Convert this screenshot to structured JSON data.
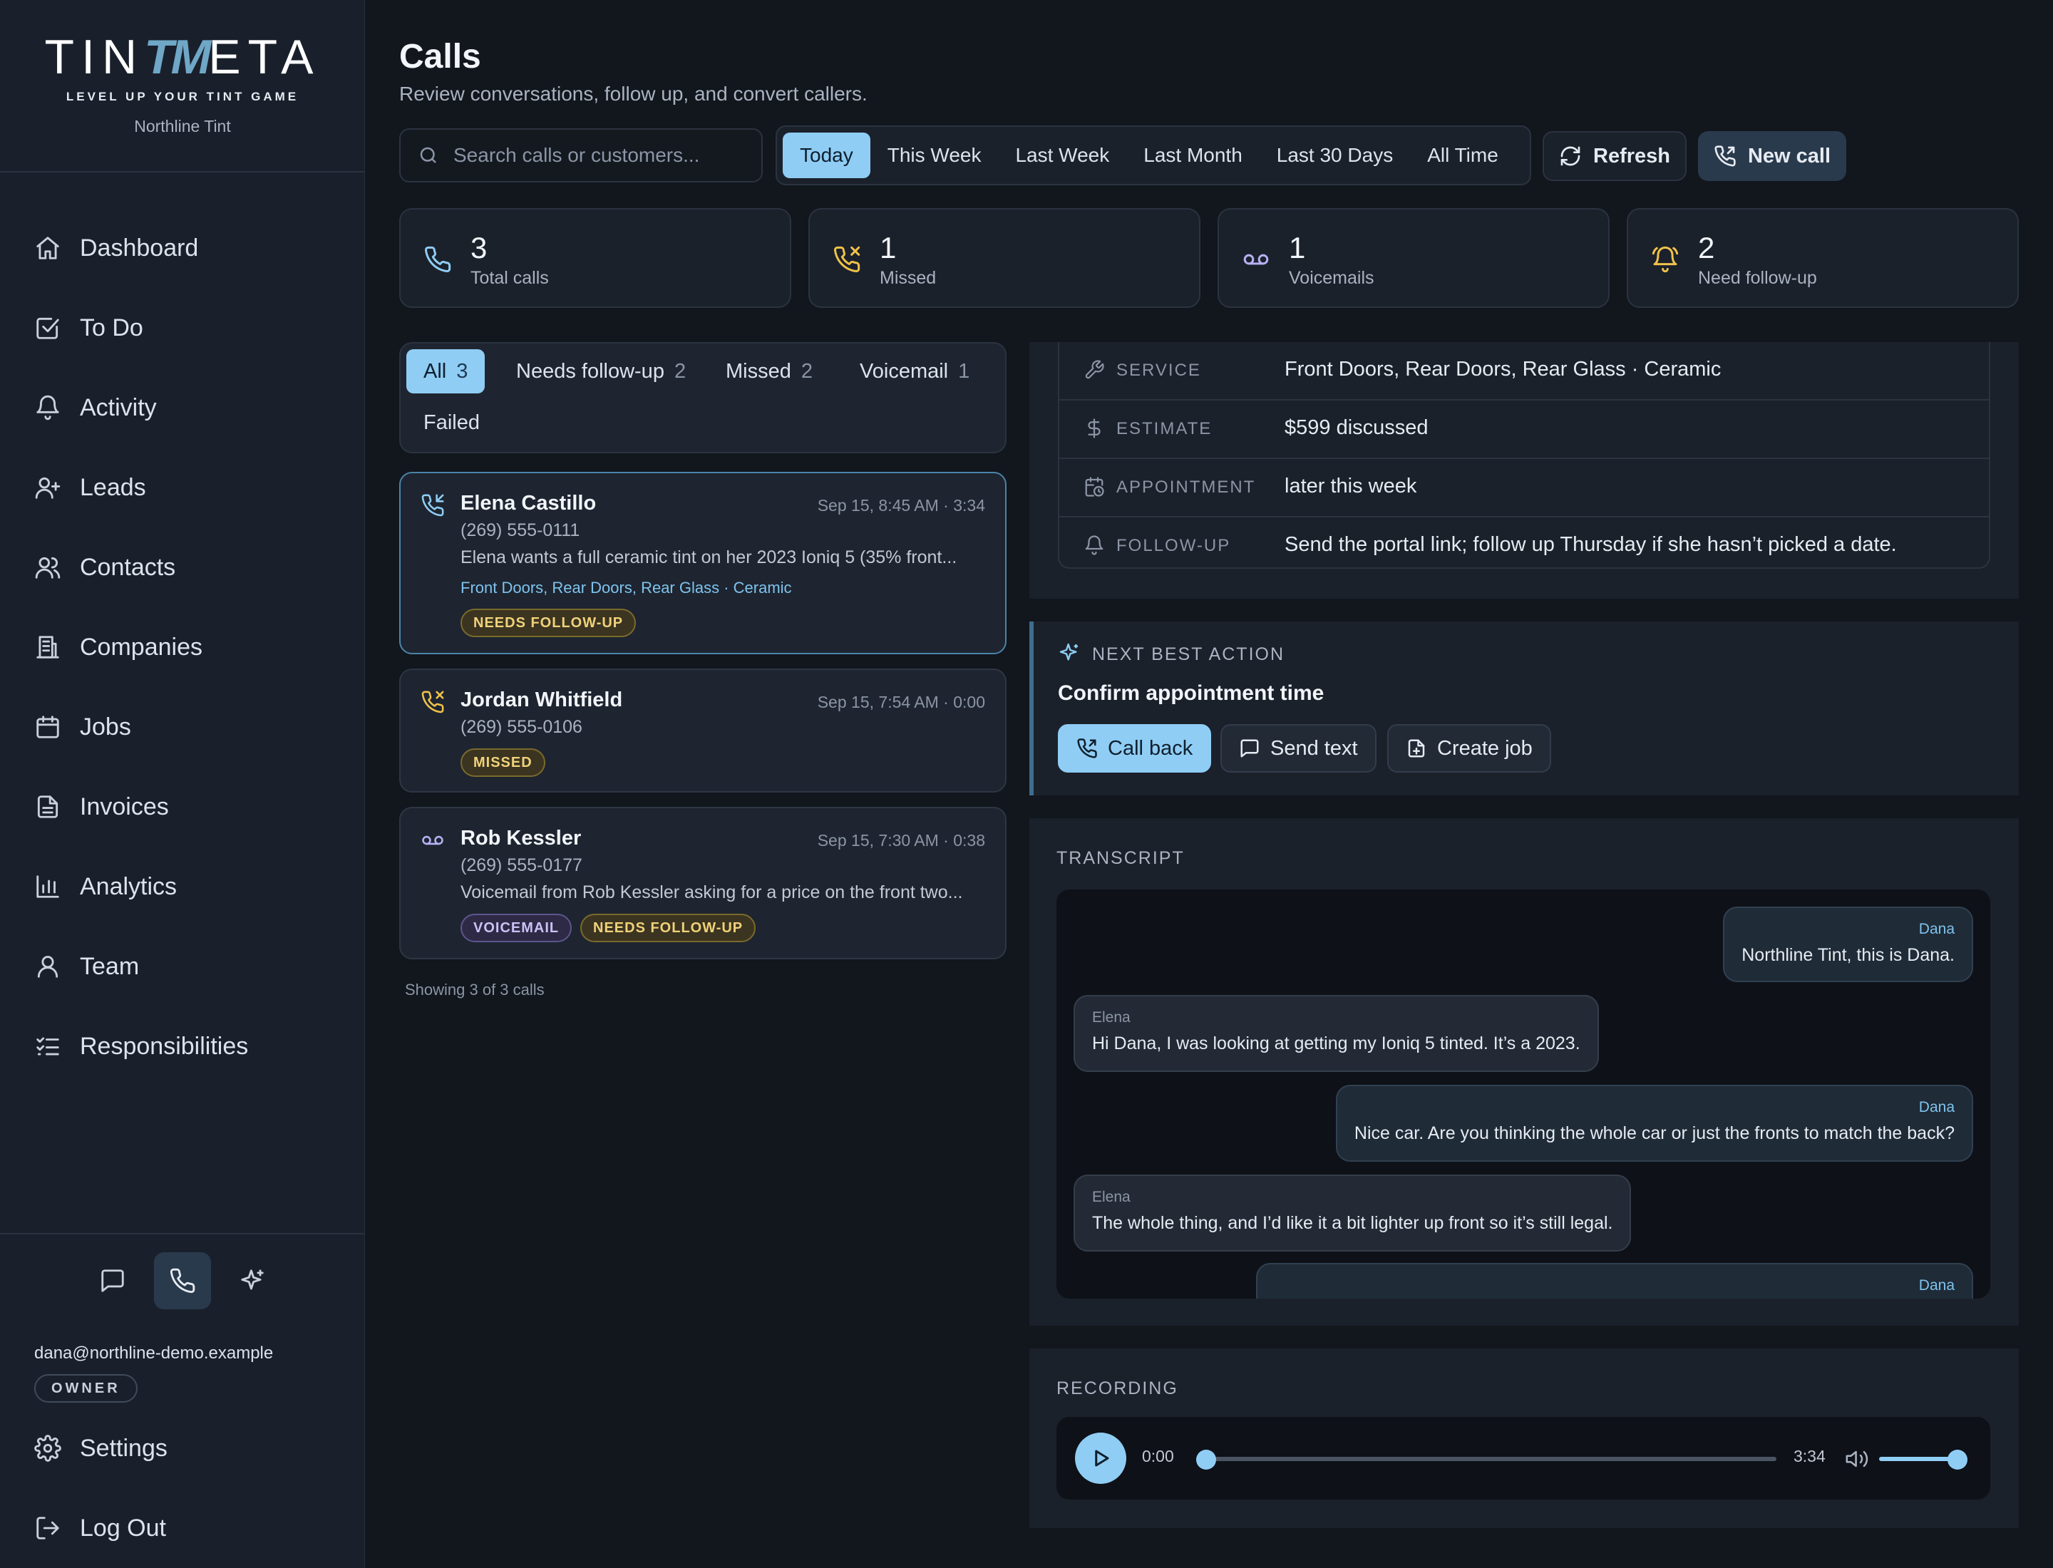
{
  "brand": {
    "wordmark_left": "TIN",
    "wordmark_accent": "TM",
    "wordmark_right": "ETA",
    "tagline": "LEVEL UP YOUR TINT GAME",
    "company": "Northline Tint"
  },
  "nav": [
    {
      "label": "Dashboard",
      "icon": "home-icon"
    },
    {
      "label": "To Do",
      "icon": "checkbox-icon"
    },
    {
      "label": "Activity",
      "icon": "bell-icon"
    },
    {
      "label": "Leads",
      "icon": "user-plus-icon"
    },
    {
      "label": "Contacts",
      "icon": "users-icon"
    },
    {
      "label": "Companies",
      "icon": "building-icon"
    },
    {
      "label": "Jobs",
      "icon": "calendar-icon"
    },
    {
      "label": "Invoices",
      "icon": "document-icon"
    },
    {
      "label": "Analytics",
      "icon": "bar-chart-icon"
    },
    {
      "label": "Team",
      "icon": "user-icon"
    },
    {
      "label": "Responsibilities",
      "icon": "list-check-icon"
    }
  ],
  "user": {
    "email": "dana@northline-demo.example",
    "role": "OWNER"
  },
  "bottom_nav": {
    "settings": "Settings",
    "logout": "Log Out"
  },
  "page": {
    "title": "Calls",
    "subtitle": "Review conversations, follow up, and convert callers."
  },
  "search": {
    "placeholder": "Search calls or customers...",
    "value": ""
  },
  "ranges": [
    "Today",
    "This Week",
    "Last Week",
    "Last Month",
    "Last 30 Days",
    "All Time"
  ],
  "active_range": "Today",
  "actions": {
    "refresh": "Refresh",
    "new_call": "New call"
  },
  "stats": [
    {
      "value": "3",
      "label": "Total calls",
      "icon": "phone-icon",
      "color": "#8fcdf5"
    },
    {
      "value": "1",
      "label": "Missed",
      "icon": "phone-missed-icon",
      "color": "#f0c24b"
    },
    {
      "value": "1",
      "label": "Voicemails",
      "icon": "voicemail-icon",
      "color": "#b9b0f5"
    },
    {
      "value": "2",
      "label": "Need follow-up",
      "icon": "bell-ring-icon",
      "color": "#f0c24b"
    }
  ],
  "filters": [
    {
      "label": "All",
      "count": "3"
    },
    {
      "label": "Needs follow-up",
      "count": "2"
    },
    {
      "label": "Missed",
      "count": "2"
    },
    {
      "label": "Voicemail",
      "count": "1"
    },
    {
      "label": "Failed",
      "count": ""
    }
  ],
  "calls": [
    {
      "name": "Elena Castillo",
      "meta": "Sep 15, 8:45 AM · 3:34",
      "phone": "(269) 555-0111",
      "summary": "Elena wants a full ceramic tint on her 2023 Ioniq 5 (35% front...",
      "services": "Front Doors, Rear Doors, Rear Glass · Ceramic",
      "badges": [
        "NEEDS FOLLOW-UP"
      ]
    },
    {
      "name": "Jordan Whitfield",
      "meta": "Sep 15, 7:54 AM · 0:00",
      "phone": "(269) 555-0106",
      "badges": [
        "MISSED"
      ]
    },
    {
      "name": "Rob Kessler",
      "meta": "Sep 15, 7:30 AM · 0:38",
      "phone": "(269) 555-0177",
      "summary": "Voicemail from Rob Kessler asking for a price on the front two...",
      "badges": [
        "VOICEMAIL",
        "NEEDS FOLLOW-UP"
      ]
    }
  ],
  "showing": "Showing 3 of 3 calls",
  "details": [
    {
      "key": "SERVICE",
      "value": "Front Doors, Rear Doors, Rear Glass · Ceramic",
      "icon": "wrench-icon"
    },
    {
      "key": "ESTIMATE",
      "value": "$599 discussed",
      "icon": "dollar-icon"
    },
    {
      "key": "APPOINTMENT",
      "value": "later this week",
      "icon": "calendar-clock-icon"
    },
    {
      "key": "FOLLOW-UP",
      "value": "Send the portal link; follow up Thursday if she hasn’t picked a date.",
      "icon": "bell-icon"
    }
  ],
  "next_action": {
    "heading": "NEXT BEST ACTION",
    "title": "Confirm appointment time",
    "call_back": "Call back",
    "send_text": "Send text",
    "create_job": "Create job"
  },
  "transcript": {
    "heading": "TRANSCRIPT",
    "messages": [
      {
        "speaker": "Dana",
        "text": "Northline Tint, this is Dana.",
        "side": "right"
      },
      {
        "speaker": "Elena",
        "text": "Hi Dana, I was looking at getting my Ioniq 5 tinted. It’s a 2023.",
        "side": "left"
      },
      {
        "speaker": "Dana",
        "text": "Nice car. Are you thinking the whole car or just the fronts to match the back?",
        "side": "right"
      },
      {
        "speaker": "Elena",
        "text": "The whole thing, and I’d like it a bit lighter up front so it’s still legal.",
        "side": "left"
      },
      {
        "speaker": "Dana",
        "text": "",
        "side": "right"
      }
    ]
  },
  "recording": {
    "heading": "RECORDING",
    "current": "0:00",
    "duration": "3:34",
    "progress": 0,
    "volume": 1
  }
}
